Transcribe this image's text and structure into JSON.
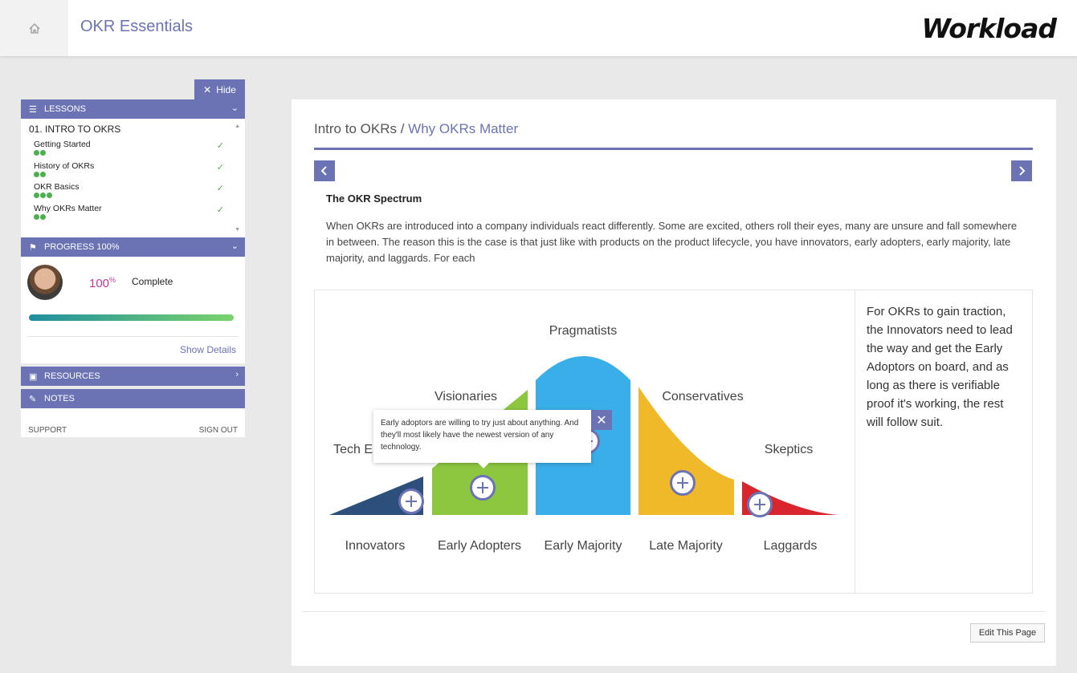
{
  "header": {
    "home_icon": "home-icon",
    "title": "OKR Essentials",
    "logo": "Workload"
  },
  "sidebar": {
    "hide_label": "Hide",
    "lessons": {
      "heading": "LESSONS",
      "module": "01. INTRO TO OKRS",
      "items": [
        {
          "label": "Getting Started",
          "dots": 2
        },
        {
          "label": "History of OKRs",
          "dots": 2
        },
        {
          "label": "OKR Basics",
          "dots": 3
        },
        {
          "label": "Why OKRs Matter",
          "dots": 2
        }
      ]
    },
    "progress": {
      "heading": "PROGRESS 100%",
      "percent": "100",
      "percent_sign": "%",
      "status": "Complete",
      "fill": 1.0,
      "show_details": "Show Details"
    },
    "resources_heading": "RESOURCES",
    "notes_heading": "NOTES",
    "support": "SUPPORT",
    "sign_out": "SIGN OUT"
  },
  "main": {
    "breadcrumb_parent": "Intro to OKRs / ",
    "breadcrumb_current": "Why OKRs Matter",
    "section_title": "The OKR Spectrum",
    "body": "When OKRs are introduced into a company individuals react differently. Some are excited, others roll their eyes, many are unsure and fall somewhere in between. The reason this is the case is that just like with products on the product lifecycle, you have innovators, early adopters, early majority, late majority, and laggards. For each",
    "side_text": "For OKRs to gain traction, the Innovators need to lead the way and get the Early Adoptors on board, and as long as there is verifiable proof it's working, the rest will follow suit.",
    "tooltip": "Early adoptors are willing to try just about anything. And they'll most likely have the newest version of any technology.",
    "edit_button": "Edit This Page",
    "diagram": {
      "top_labels": [
        "Tech En",
        "Visionaries",
        "Pragmatists",
        "Conservatives",
        "Skeptics"
      ],
      "bottom_labels": [
        "Innovators",
        "Early Adopters",
        "Early Majority",
        "Late Majority",
        "Laggards"
      ],
      "colors": [
        "#2d4f7c",
        "#8dc63f",
        "#3aaee8",
        "#f0b929",
        "#d9262e"
      ]
    }
  }
}
